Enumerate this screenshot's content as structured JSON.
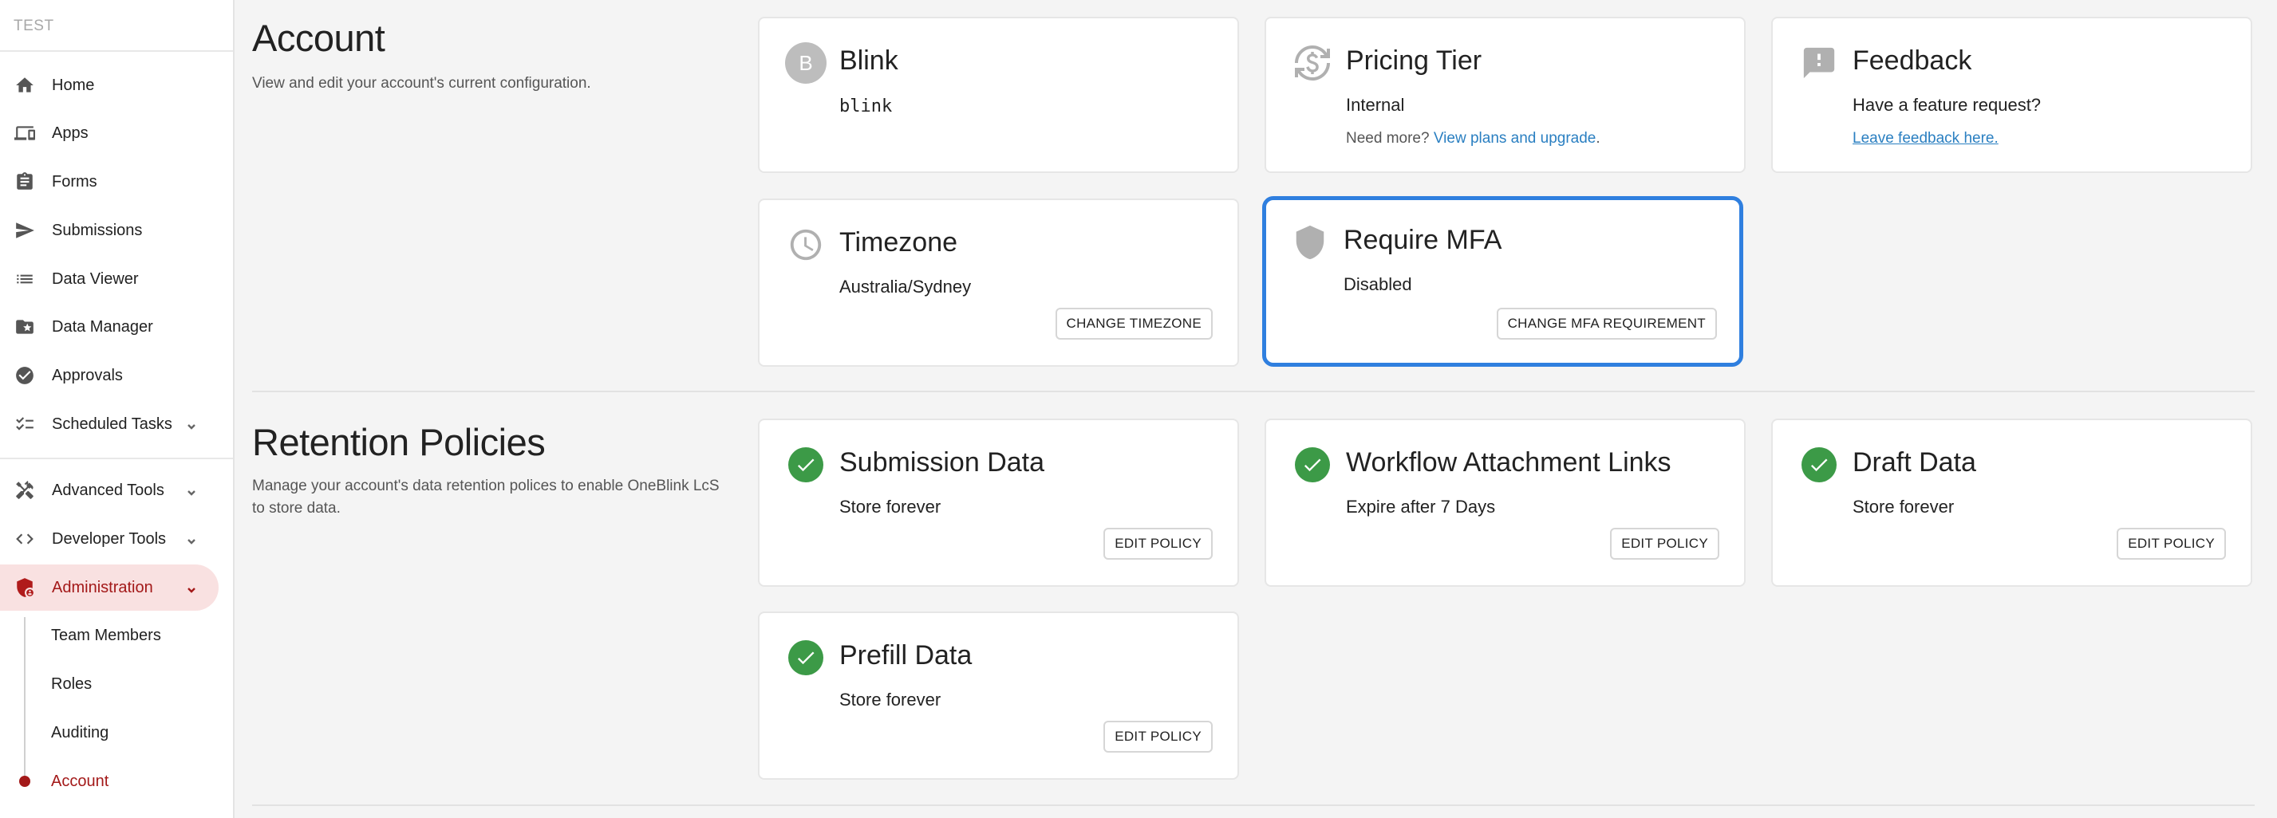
{
  "sidebar": {
    "env_label": "TEST",
    "items": [
      {
        "label": "Home",
        "icon": "home-icon"
      },
      {
        "label": "Apps",
        "icon": "devices-icon"
      },
      {
        "label": "Forms",
        "icon": "clipboard-icon"
      },
      {
        "label": "Submissions",
        "icon": "send-icon"
      },
      {
        "label": "Data Viewer",
        "icon": "list-icon"
      },
      {
        "label": "Data Manager",
        "icon": "folder-star-icon"
      },
      {
        "label": "Approvals",
        "icon": "check-circle-icon"
      },
      {
        "label": "Scheduled Tasks",
        "icon": "checklist-icon"
      },
      {
        "label": "Advanced Tools",
        "icon": "tools-icon"
      },
      {
        "label": "Developer Tools",
        "icon": "code-icon"
      },
      {
        "label": "Administration",
        "icon": "admin-shield-icon"
      }
    ],
    "sub_items": [
      {
        "label": "Team Members"
      },
      {
        "label": "Roles"
      },
      {
        "label": "Auditing"
      },
      {
        "label": "Account"
      }
    ]
  },
  "account": {
    "title": "Account",
    "description": "View and edit your account's current configuration.",
    "cards": {
      "blink": {
        "avatar_letter": "B",
        "title": "Blink",
        "value": "blink"
      },
      "pricing": {
        "title": "Pricing Tier",
        "value": "Internal",
        "sub_prefix": "Need more?",
        "sub_link": "View plans and upgrade",
        "sub_suffix": "."
      },
      "feedback": {
        "title": "Feedback",
        "value": "Have a feature request?",
        "link": "Leave feedback here."
      },
      "timezone": {
        "title": "Timezone",
        "value": "Australia/Sydney",
        "button": "CHANGE TIMEZONE"
      },
      "mfa": {
        "title": "Require MFA",
        "value": "Disabled",
        "button": "CHANGE MFA REQUIREMENT"
      }
    }
  },
  "retention": {
    "title": "Retention Policies",
    "description": "Manage your account's data retention polices to enable OneBlink LcS to store data.",
    "cards": {
      "submission": {
        "title": "Submission Data",
        "value": "Store forever",
        "button": "EDIT POLICY"
      },
      "workflow": {
        "title": "Workflow Attachment Links",
        "value": "Expire after 7 Days",
        "button": "EDIT POLICY"
      },
      "draft": {
        "title": "Draft Data",
        "value": "Store forever",
        "button": "EDIT POLICY"
      },
      "prefill": {
        "title": "Prefill Data",
        "value": "Store forever",
        "button": "EDIT POLICY"
      }
    }
  },
  "colors": {
    "accent": "#a31919",
    "focus": "#2f7fdf",
    "success": "#3c9a47",
    "link": "#2a7fc1"
  }
}
